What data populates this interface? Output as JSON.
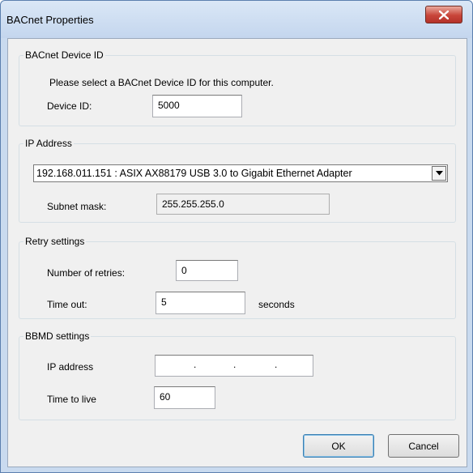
{
  "window": {
    "title": "BACnet Properties"
  },
  "device_group": {
    "legend": "BACnet Device ID",
    "prompt": "Please select a BACnet Device ID for this computer.",
    "device_id_label": "Device ID:",
    "device_id_value": "5000"
  },
  "ip_group": {
    "legend": "IP Address",
    "adapter_selected": "192.168.011.151 : ASIX AX88179 USB 3.0 to Gigabit Ethernet Adapter",
    "subnet_label": "Subnet mask:",
    "subnet_value": "255.255.255.0"
  },
  "retry_group": {
    "legend": "Retry settings",
    "retries_label": "Number of retries:",
    "retries_value": "0",
    "timeout_label": "Time out:",
    "timeout_value": "5",
    "timeout_unit": "seconds"
  },
  "bbmd_group": {
    "legend": "BBMD settings",
    "ip_label": "IP address",
    "ip_separator": ".",
    "ttl_label": "Time to live",
    "ttl_value": "60"
  },
  "buttons": {
    "ok": "OK",
    "cancel": "Cancel"
  },
  "icons": {
    "close": "close-icon",
    "dropdown": "chevron-down-icon"
  }
}
